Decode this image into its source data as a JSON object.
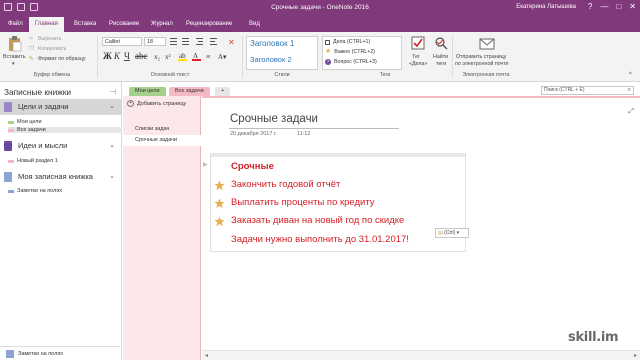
{
  "window": {
    "title": "Срочные задачи  -  OneNote 2016",
    "user": "Екатерина Латышева",
    "controls": {
      "help": "?",
      "minimize": "—",
      "maximize": "□",
      "close": "✕"
    }
  },
  "tabs": [
    "Файл",
    "Главная",
    "Вставка",
    "Рисование",
    "Журнал",
    "Рецензирование",
    "Вид"
  ],
  "ribbon": {
    "clipboard": {
      "paste": "Вставить",
      "cut": "Вырезать",
      "copy": "Копировать",
      "format_painter": "Формат по образцу",
      "group": "Буфер обмена"
    },
    "basic_text": {
      "font": "Calibri",
      "size": "18",
      "group": "Основной текст"
    },
    "styles": {
      "heading1": "Заголовок 1",
      "heading2": "Заголовок 2",
      "group": "Стили"
    },
    "tags": {
      "items": [
        "Дела (CTRL+1)",
        "Важно (CTRL+2)",
        "Вопрос (CTRL+3)"
      ],
      "todo_tag": "Тег",
      "todo_tag2": "«Дела»",
      "find_tags": "Найти",
      "find_tags2": "теги",
      "group": "Теги"
    },
    "email": {
      "send": "Отправить страницу",
      "send2": "по электронной почте",
      "group": "Электронная почта"
    }
  },
  "notebooks": {
    "header": "Записные книжки",
    "pin": "⊣",
    "items": [
      {
        "name": "Цели и задачи",
        "color": "#9b84c7",
        "sections": [
          {
            "name": "Мои цели",
            "color": "#a8d08d"
          },
          {
            "name": "Все задачи",
            "color": "#f4b9c2"
          }
        ]
      },
      {
        "name": "Идеи и мысли",
        "color": "#6a4aa0",
        "sections": [
          {
            "name": "Новый раздел 1",
            "color": "#f4b9c2"
          }
        ]
      },
      {
        "name": "Моя записная книжка",
        "color": "#8aa2d6",
        "sections": [
          {
            "name": "Заметки на полях",
            "color": "#8aa2d6"
          }
        ]
      }
    ],
    "footer": "Заметки на полях"
  },
  "section_tabs": [
    "Мои цели",
    "Все задачи",
    "+"
  ],
  "search": {
    "placeholder": "Поиск (CTRL + E)"
  },
  "pages": {
    "add": "Добавить страницу",
    "items": [
      "Списки задач",
      "Срочные задачи"
    ]
  },
  "page": {
    "title": "Срочные задачи",
    "date": "20 декабря 2017 г.",
    "time": "11:12",
    "lines": [
      {
        "text": "Срочные",
        "star": false,
        "bold": true
      },
      {
        "text": "Закончить годовой отчёт",
        "star": true
      },
      {
        "text": "Выплатить проценты по кредиту",
        "star": true
      },
      {
        "text": "Заказать диван на новый год по скидке",
        "star": true
      },
      {
        "text": "Задачи нужно выполнить до 31.01.2017!",
        "star": false
      }
    ],
    "paste_options": "(Ctrl) ▾"
  },
  "watermark": "skill.im",
  "colors": {
    "brand": "#80397b",
    "task_text": "#d42027",
    "star": "#e8b04b",
    "section_green": "#a8d08d",
    "section_pink": "#f4b9c2"
  }
}
